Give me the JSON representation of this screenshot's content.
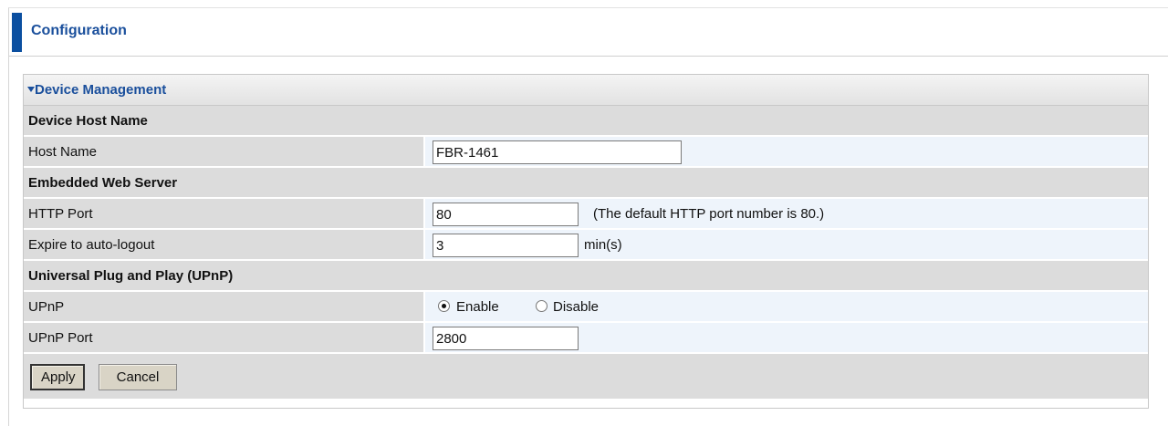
{
  "header": {
    "title": "Configuration"
  },
  "panel": {
    "title": "Device Management",
    "sections": {
      "host": {
        "title": "Device Host Name",
        "host_name_label": "Host Name",
        "host_name_value": "FBR-1461"
      },
      "web": {
        "title": "Embedded Web Server",
        "http_port_label": "HTTP Port",
        "http_port_value": "80",
        "http_port_hint": "(The default HTTP port number is 80.)",
        "expire_label": "Expire to auto-logout",
        "expire_value": "3",
        "expire_unit": "min(s)"
      },
      "upnp": {
        "title": "Universal Plug and Play (UPnP)",
        "upnp_label": "UPnP",
        "enable_label": "Enable",
        "disable_label": "Disable",
        "selected": "Enable",
        "port_label": "UPnP Port",
        "port_value": "2800"
      }
    },
    "buttons": {
      "apply": "Apply",
      "cancel": "Cancel"
    }
  }
}
